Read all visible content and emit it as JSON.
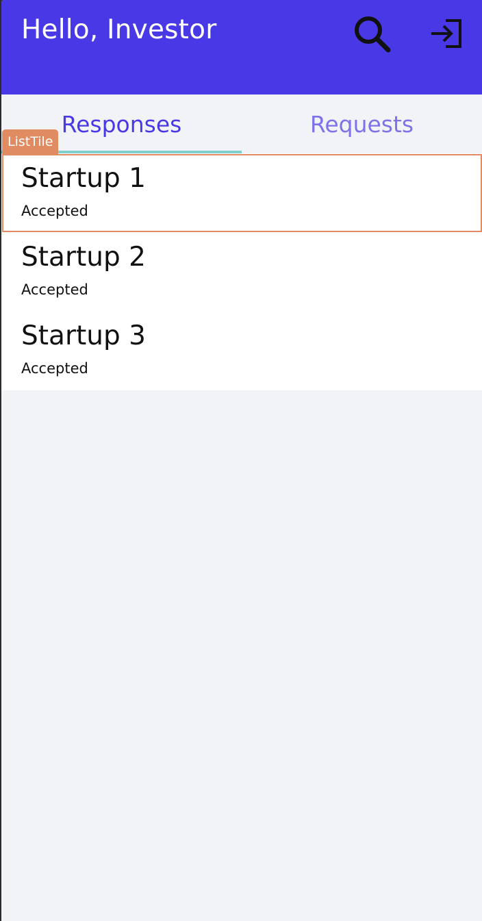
{
  "app_bar": {
    "title": "Hello, Investor",
    "background_color": "#4838e6",
    "search_icon": "search-icon",
    "login_icon": "login-icon"
  },
  "tabs": [
    {
      "label": "Responses",
      "selected": true,
      "color": "#4838e6"
    },
    {
      "label": "Requests",
      "selected": false,
      "color": "#7d72ea"
    }
  ],
  "tab_indicator_color": "#7fd0cc",
  "responses": [
    {
      "title": "Startup 1",
      "subtitle": "Accepted"
    },
    {
      "title": "Startup 2",
      "subtitle": "Accepted"
    },
    {
      "title": "Startup 3",
      "subtitle": "Accepted"
    }
  ],
  "debug_overlay": {
    "label": "ListTile",
    "color": "#e08b62"
  }
}
